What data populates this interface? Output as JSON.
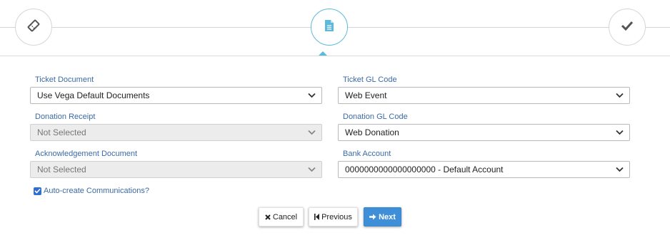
{
  "wizard": {
    "steps": [
      {
        "icon": "ticket-icon",
        "state": "complete"
      },
      {
        "icon": "document-icon",
        "state": "active"
      },
      {
        "icon": "checkmark-icon",
        "state": "pending"
      }
    ],
    "accent_color": "#5cbadb"
  },
  "form": {
    "ticket_document": {
      "label": "Ticket Document",
      "value": "Use Vega Default Documents"
    },
    "ticket_gl_code": {
      "label": "Ticket GL Code",
      "value": "Web Event"
    },
    "donation_receipt": {
      "label": "Donation Receipt",
      "value": "Not Selected"
    },
    "donation_gl_code": {
      "label": "Donation GL Code",
      "value": "Web Donation"
    },
    "acknowledgement_document": {
      "label": "Acknowledgement Document",
      "value": "Not Selected"
    },
    "bank_account": {
      "label": "Bank Account",
      "value": "0000000000000000000 - Default Account"
    },
    "auto_create": {
      "label": "Auto-create Communications?",
      "checked": true
    }
  },
  "buttons": {
    "cancel": "Cancel",
    "previous": "Previous",
    "next": "Next"
  },
  "colors": {
    "label": "#3b6aa8",
    "primary_button": "#3e8fd8",
    "checkbox": "#2f6fd1"
  }
}
